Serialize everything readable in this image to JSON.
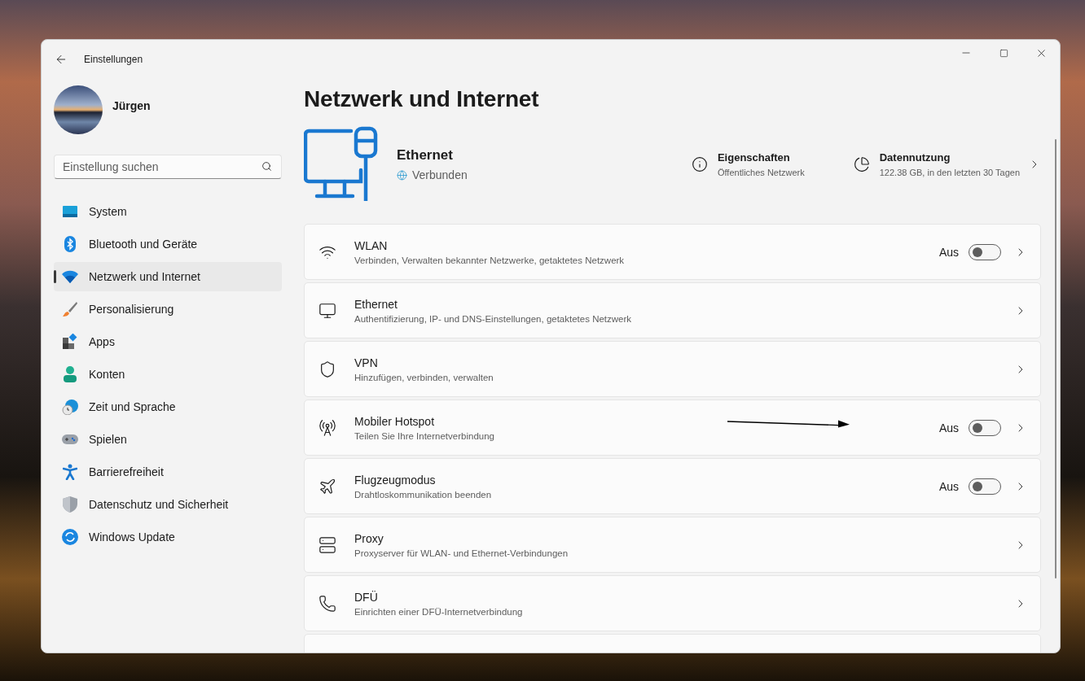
{
  "window": {
    "title": "Einstellungen"
  },
  "profile": {
    "name": "Jürgen"
  },
  "search": {
    "placeholder": "Einstellung suchen"
  },
  "sidebar": {
    "items": [
      {
        "label": "System",
        "selected": false
      },
      {
        "label": "Bluetooth und Geräte",
        "selected": false
      },
      {
        "label": "Netzwerk und Internet",
        "selected": true
      },
      {
        "label": "Personalisierung",
        "selected": false
      },
      {
        "label": "Apps",
        "selected": false
      },
      {
        "label": "Konten",
        "selected": false
      },
      {
        "label": "Zeit und Sprache",
        "selected": false
      },
      {
        "label": "Spielen",
        "selected": false
      },
      {
        "label": "Barrierefreiheit",
        "selected": false
      },
      {
        "label": "Datenschutz und Sicherheit",
        "selected": false
      },
      {
        "label": "Windows Update",
        "selected": false
      }
    ]
  },
  "page": {
    "title": "Netzwerk und Internet",
    "connection": {
      "name": "Ethernet",
      "status": "Verbunden"
    },
    "properties": {
      "label": "Eigenschaften",
      "value": "Öffentliches Netzwerk"
    },
    "data_usage": {
      "label": "Datennutzung",
      "value": "122.38 GB, in den letzten 30 Tagen"
    }
  },
  "settings": [
    {
      "title": "WLAN",
      "description": "Verbinden, Verwalten bekannter Netzwerke, getaktetes Netzwerk",
      "toggle": {
        "label": "Aus",
        "on": false
      }
    },
    {
      "title": "Ethernet",
      "description": "Authentifizierung, IP- und DNS-Einstellungen, getaktetes Netzwerk"
    },
    {
      "title": "VPN",
      "description": "Hinzufügen, verbinden, verwalten"
    },
    {
      "title": "Mobiler Hotspot",
      "description": "Teilen Sie Ihre Internetverbindung",
      "toggle": {
        "label": "Aus",
        "on": false
      }
    },
    {
      "title": "Flugzeugmodus",
      "description": "Drahtloskommunikation beenden",
      "toggle": {
        "label": "Aus",
        "on": false
      }
    },
    {
      "title": "Proxy",
      "description": "Proxyserver für WLAN- und Ethernet-Verbindungen"
    },
    {
      "title": "DFÜ",
      "description": "Einrichten einer DFÜ-Internetverbindung"
    }
  ]
}
